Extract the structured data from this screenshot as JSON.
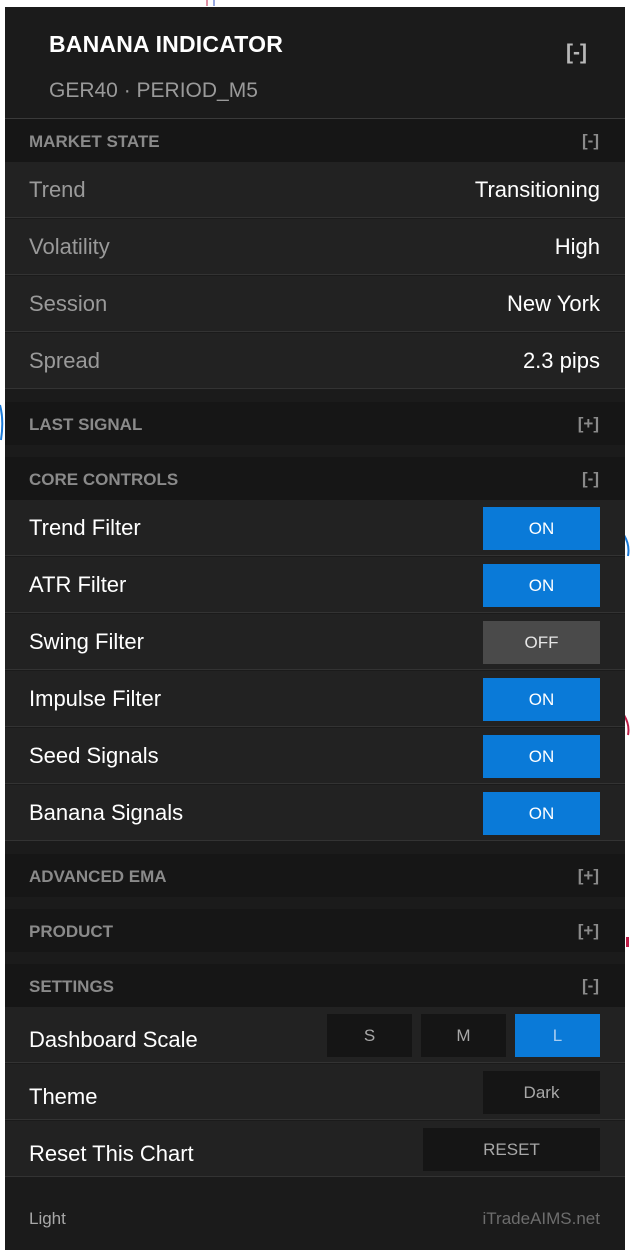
{
  "header": {
    "title": "BANANA INDICATOR",
    "subtitle": "GER40 · PERIOD_M5",
    "collapse": "[-]"
  },
  "sections": {
    "market_state": {
      "label": "MARKET STATE",
      "toggle": "[-]"
    },
    "last_signal": {
      "label": "LAST SIGNAL",
      "toggle": "[+]"
    },
    "core_controls": {
      "label": "CORE CONTROLS",
      "toggle": "[-]"
    },
    "advanced_ema": {
      "label": "ADVANCED EMA",
      "toggle": "[+]"
    },
    "product": {
      "label": "PRODUCT",
      "toggle": "[+]"
    },
    "settings": {
      "label": "SETTINGS",
      "toggle": "[-]"
    }
  },
  "market": [
    {
      "key": "Trend",
      "value": "Transitioning"
    },
    {
      "key": "Volatility",
      "value": "High"
    },
    {
      "key": "Session",
      "value": "New York"
    },
    {
      "key": "Spread",
      "value": "2.3 pips"
    }
  ],
  "controls": [
    {
      "label": "Trend Filter",
      "state": "ON"
    },
    {
      "label": "ATR Filter",
      "state": "ON"
    },
    {
      "label": "Swing Filter",
      "state": "OFF"
    },
    {
      "label": "Impulse Filter",
      "state": "ON"
    },
    {
      "label": "Seed Signals",
      "state": "ON"
    },
    {
      "label": "Banana Signals",
      "state": "ON"
    }
  ],
  "settings": {
    "scale_label": "Dashboard Scale",
    "scale_options": [
      "S",
      "M",
      "L"
    ],
    "scale_selected": "L",
    "theme_label": "Theme",
    "theme_value": "Dark",
    "reset_label": "Reset This Chart",
    "reset_button": "RESET"
  },
  "footer": {
    "left": "Light",
    "right": "iTradeAIMS.net"
  },
  "colors": {
    "accent_on": "#0a7ad8",
    "off": "#4a4a4a",
    "panel": "#1b1b1b"
  }
}
